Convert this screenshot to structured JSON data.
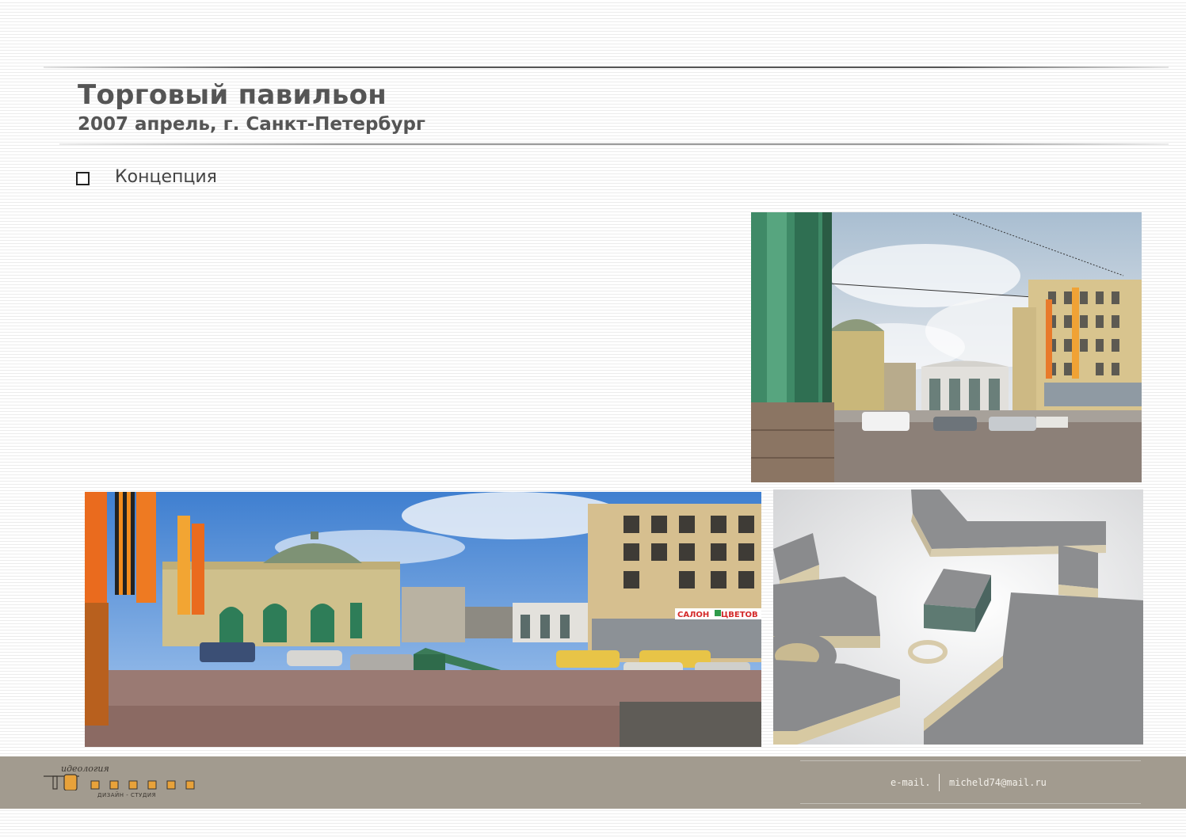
{
  "header": {
    "title": "Торговый павильон",
    "subtitle": "2007 апрель, г. Санкт-Петербург"
  },
  "bullet": {
    "label": "Концепция"
  },
  "footer": {
    "email_label": "e-mail.",
    "email_address": "micheld74@mail.ru",
    "logo_top": "идеология",
    "logo_bottom": "ДИЗАЙН - СТУДИЯ"
  },
  "photo_texts": {
    "shop_sign_left": "САЛОН",
    "shop_sign_right": "ЦВЕТОВ"
  },
  "colors": {
    "footer_bg": "#a29b8f",
    "title_text": "#555555",
    "logo_accent": "#e8a23a"
  }
}
